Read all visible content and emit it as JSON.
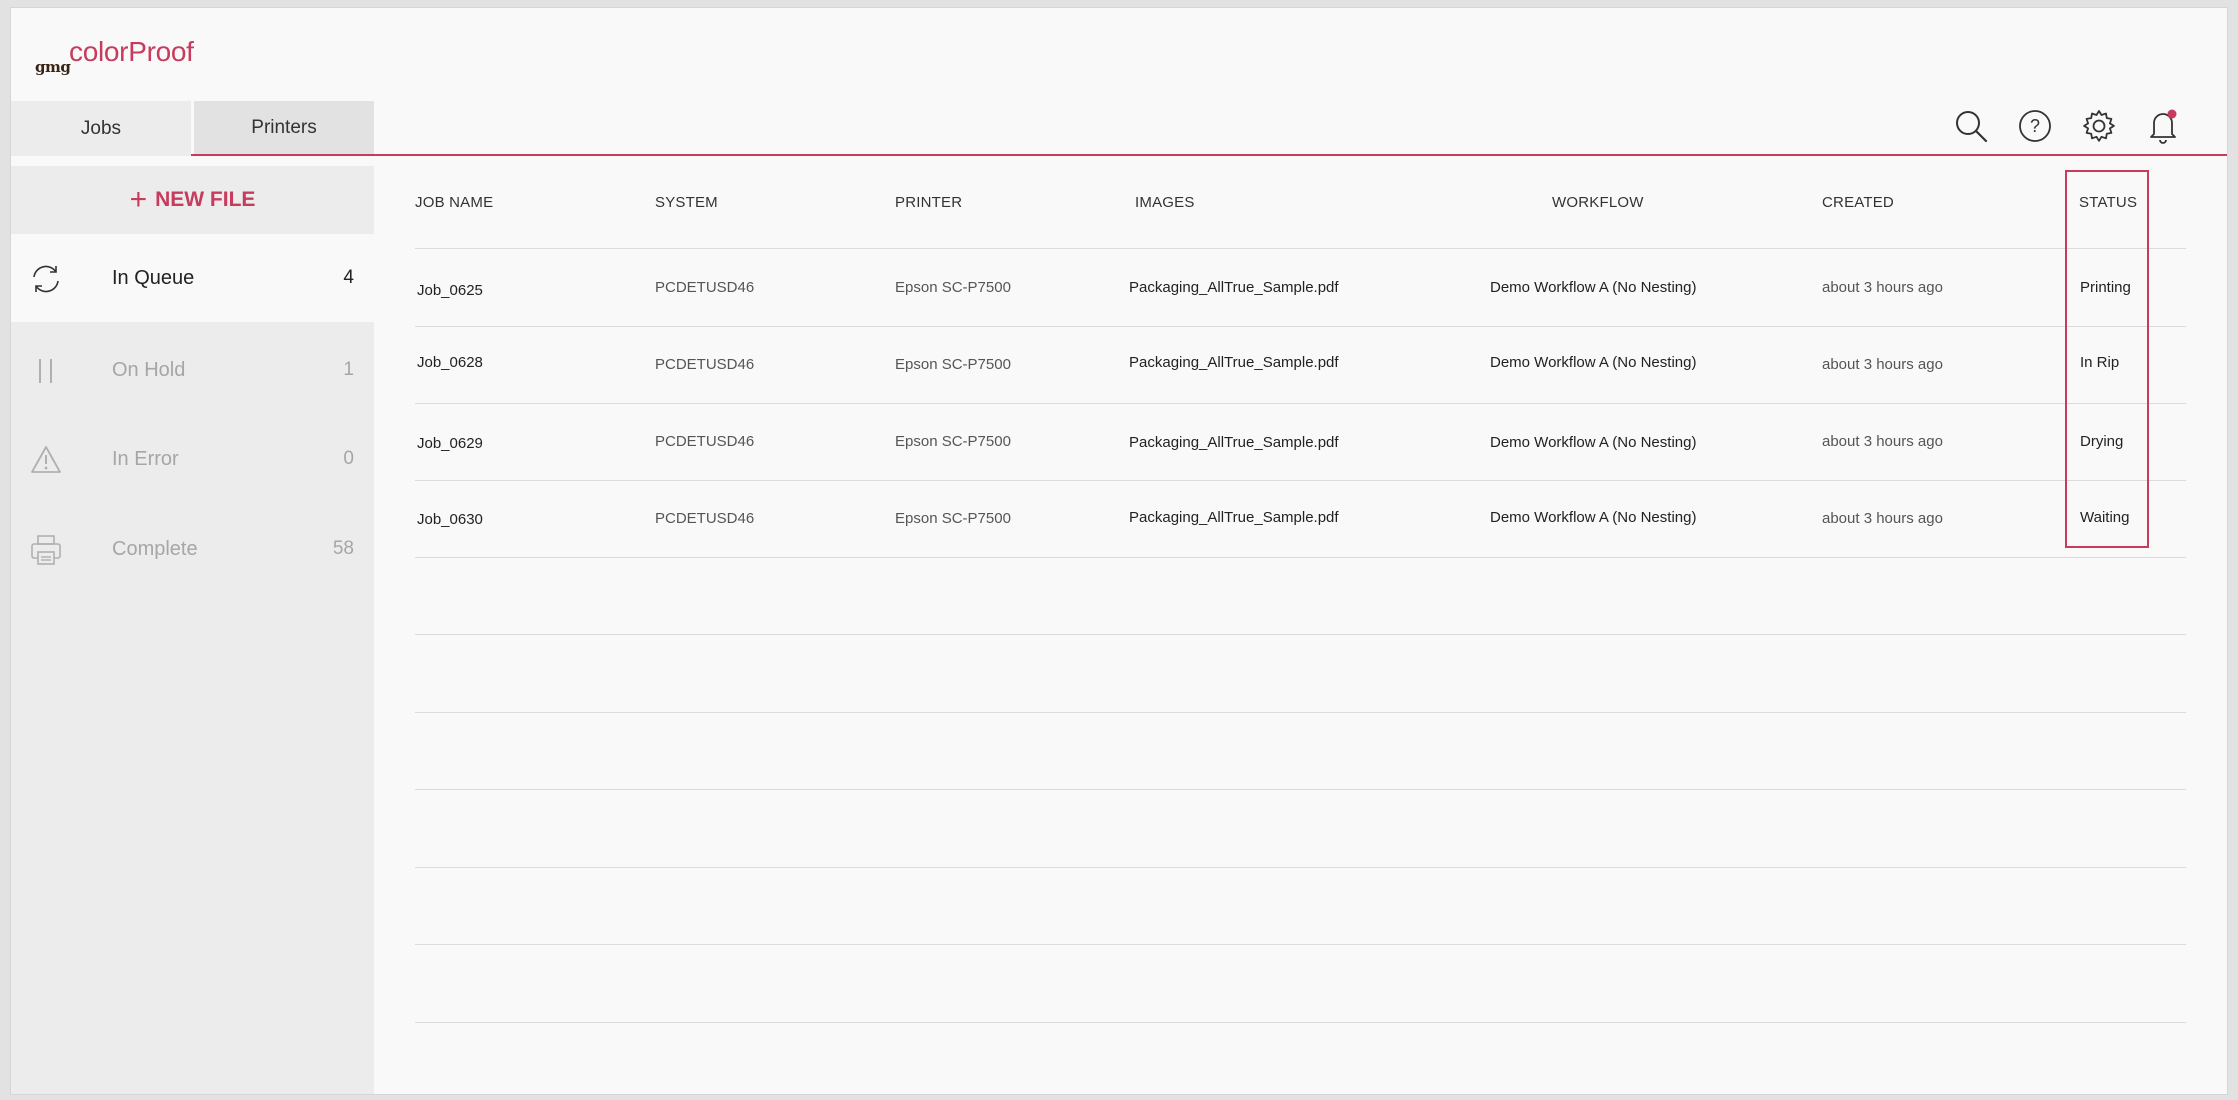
{
  "logo": {
    "brand_small": "gmg",
    "brand_name": "colorProof"
  },
  "tabs": [
    {
      "label": "Jobs",
      "active": true
    },
    {
      "label": "Printers",
      "active": false
    }
  ],
  "toolbar": {
    "icons": [
      "search-icon",
      "help-icon",
      "gear-icon",
      "bell-icon"
    ],
    "notification_dot_color": "#c73b5c"
  },
  "sidebar": {
    "new_file_label": "NEW FILE",
    "items": [
      {
        "label": "In Queue",
        "count": "4",
        "icon": "refresh-icon",
        "active": true
      },
      {
        "label": "On Hold",
        "count": "1",
        "icon": "pause-icon",
        "active": false
      },
      {
        "label": "In Error",
        "count": "0",
        "icon": "warning-icon",
        "active": false
      },
      {
        "label": "Complete",
        "count": "58",
        "icon": "printer-icon",
        "active": false
      }
    ]
  },
  "table": {
    "headers": [
      "JOB NAME",
      "SYSTEM",
      "PRINTER",
      "IMAGES",
      "WORKFLOW",
      "CREATED",
      "STATUS"
    ],
    "rows": [
      {
        "job": "Job_0625",
        "system": "PCDETUSD46",
        "printer": "Epson SC-P7500",
        "images": "Packaging_AllTrue_Sample.pdf",
        "workflow": "Demo Workflow A (No Nesting)",
        "created": "about 3 hours ago",
        "status": "Printing"
      },
      {
        "job": "Job_0628",
        "system": "PCDETUSD46",
        "printer": "Epson SC-P7500",
        "images": "Packaging_AllTrue_Sample.pdf",
        "workflow": "Demo Workflow A (No Nesting)",
        "created": "about 3 hours ago",
        "status": "In Rip"
      },
      {
        "job": "Job_0629",
        "system": "PCDETUSD46",
        "printer": "Epson SC-P7500",
        "images": "Packaging_AllTrue_Sample.pdf",
        "workflow": "Demo Workflow A (No Nesting)",
        "created": "about 3 hours ago",
        "status": "Drying"
      },
      {
        "job": "Job_0630",
        "system": "PCDETUSD46",
        "printer": "Epson SC-P7500",
        "images": "Packaging_AllTrue_Sample.pdf",
        "workflow": "Demo Workflow A (No Nesting)",
        "created": "about 3 hours ago",
        "status": "Waiting"
      }
    ]
  },
  "colors": {
    "accent": "#c73b5c",
    "sidebar_bg": "#ececec",
    "main_bg": "#f9f9f9"
  }
}
